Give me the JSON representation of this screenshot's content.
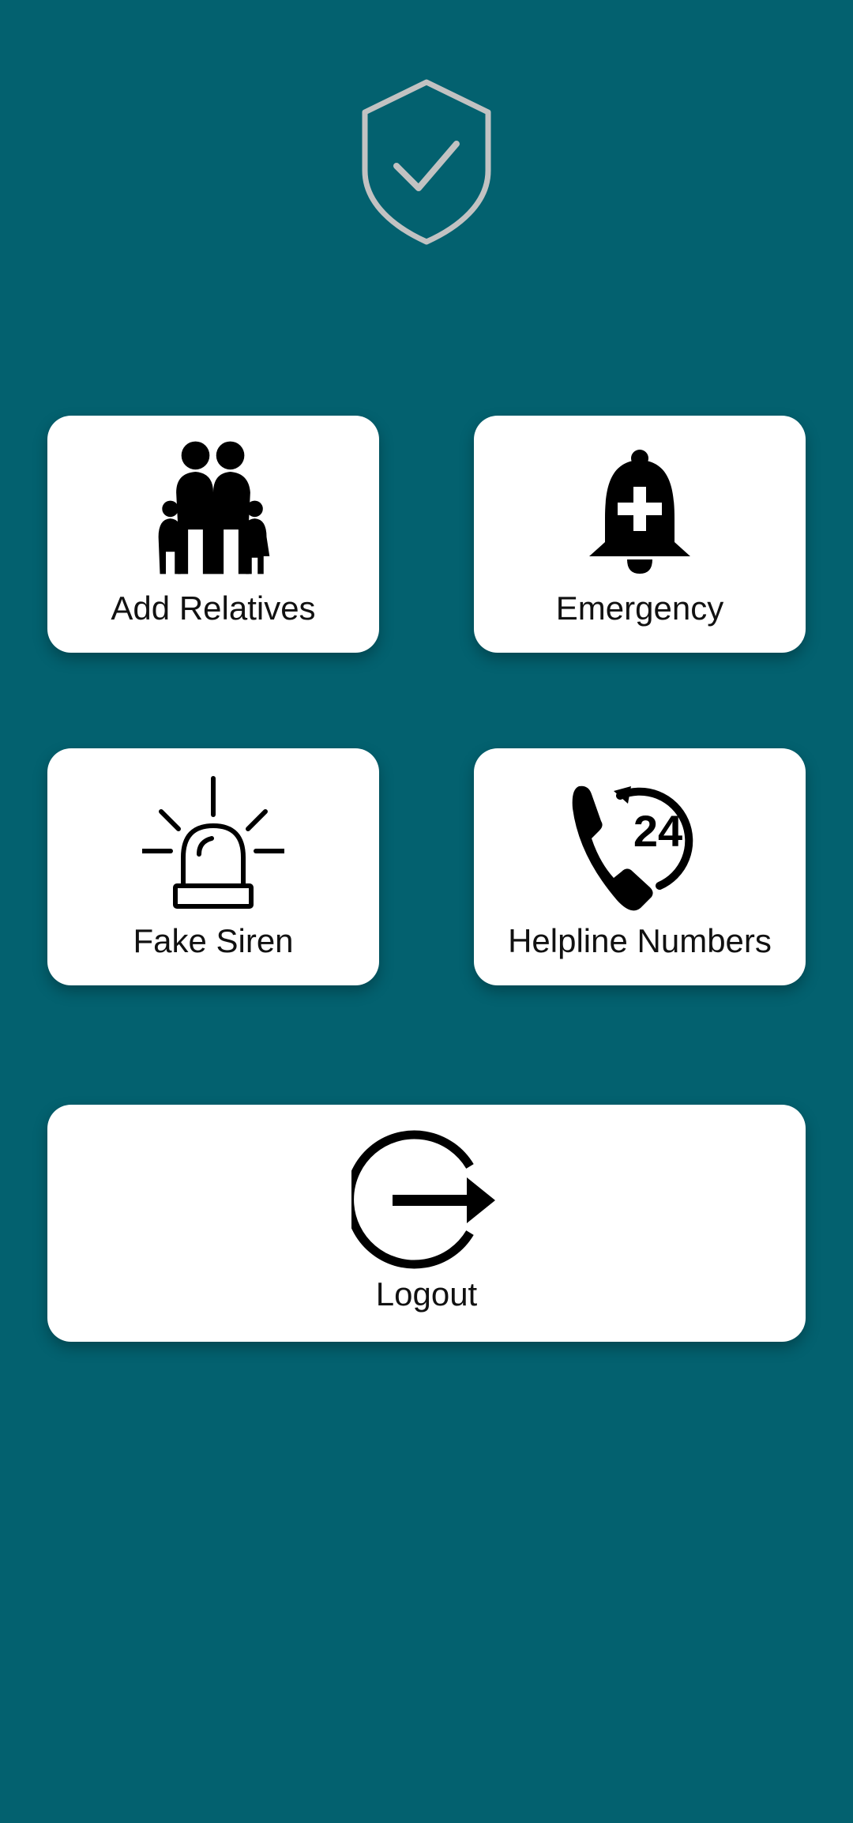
{
  "header": {
    "logo_icon": "shield-check-icon"
  },
  "menu": {
    "add_relatives": {
      "label": "Add Relatives",
      "icon": "family-icon"
    },
    "emergency": {
      "label": "Emergency",
      "icon": "emergency-bell-icon"
    },
    "fake_siren": {
      "label": "Fake Siren",
      "icon": "siren-icon"
    },
    "helpline": {
      "label": "Helpline Numbers",
      "icon": "phone-24-icon",
      "icon_text": "24"
    },
    "logout": {
      "label": "Logout",
      "icon": "logout-icon"
    }
  },
  "colors": {
    "background": "#03616f",
    "card": "#ffffff",
    "text": "#111111",
    "logo_stroke": "#c2c2c2"
  }
}
